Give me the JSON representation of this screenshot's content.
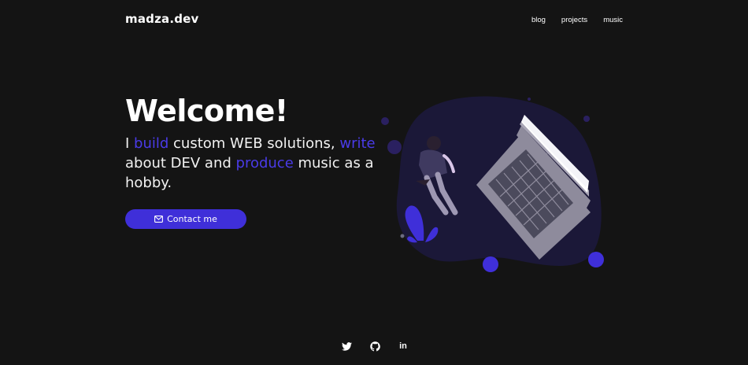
{
  "header": {
    "logo": "madza.dev",
    "nav": [
      {
        "label": "blog"
      },
      {
        "label": "projects"
      },
      {
        "label": "music"
      }
    ]
  },
  "hero": {
    "title": "Welcome!",
    "tagline": {
      "p1": "I ",
      "w1": "build",
      "p2": " custom WEB solutions, ",
      "w2": "write",
      "p3": " about DEV and ",
      "w3": "produce",
      "p4": " music as a hobby."
    },
    "contact_label": "Contact me",
    "contact_icon": "mail-icon"
  },
  "socials": [
    {
      "icon": "twitter-icon"
    },
    {
      "icon": "github-icon"
    },
    {
      "icon": "linkedin-icon",
      "text": "in"
    }
  ],
  "colors": {
    "background": "#141414",
    "accent": "#4a3be8",
    "button": "#3f2fd9",
    "blob": "#1b1838"
  }
}
